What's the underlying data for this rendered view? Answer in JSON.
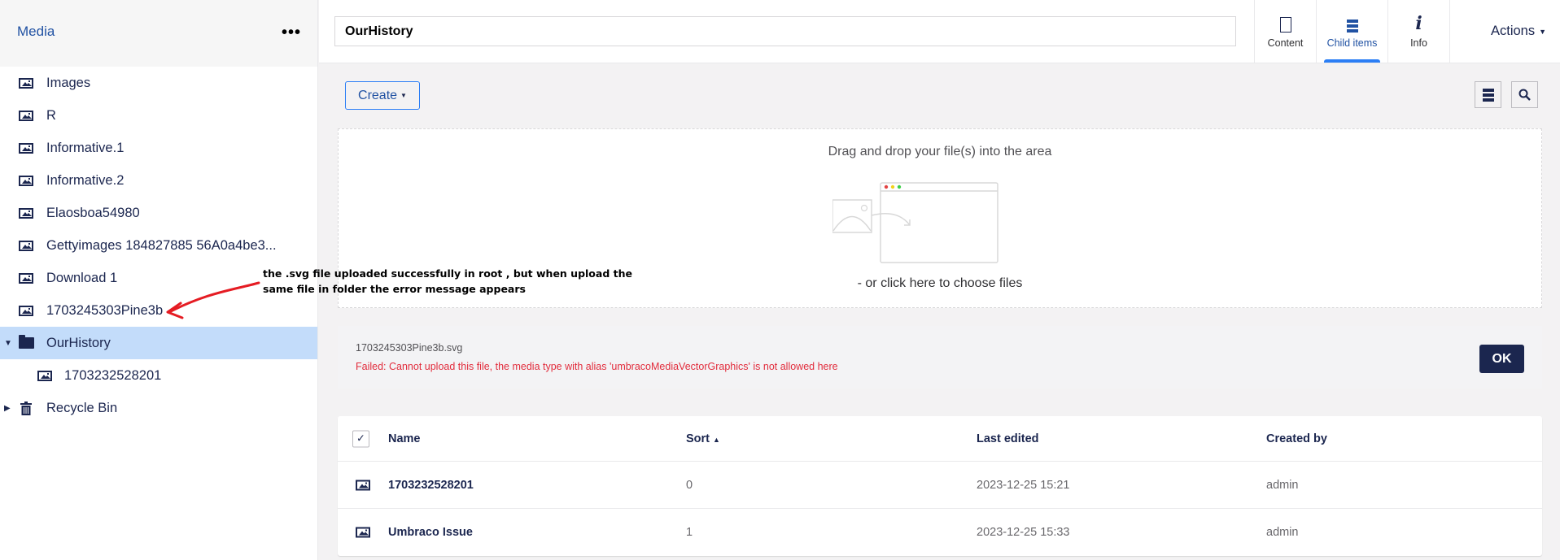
{
  "sidebar": {
    "title": "Media",
    "more_icon": "ellipsis-icon",
    "items": [
      {
        "label": "Images",
        "icon": "image-icon"
      },
      {
        "label": "R",
        "icon": "image-icon"
      },
      {
        "label": "Informative.1",
        "icon": "image-icon"
      },
      {
        "label": "Informative.2",
        "icon": "image-icon"
      },
      {
        "label": "Elaosboa54980",
        "icon": "image-icon"
      },
      {
        "label": "Gettyimages 184827885 56A0a4be3...",
        "icon": "image-icon"
      },
      {
        "label": "Download 1",
        "icon": "image-icon"
      },
      {
        "label": "1703245303Pine3b",
        "icon": "image-icon"
      },
      {
        "label": "OurHistory",
        "icon": "folder-icon",
        "expanded": true,
        "active": true
      },
      {
        "label": "1703232528201",
        "icon": "image-icon",
        "child": true
      },
      {
        "label": "Recycle Bin",
        "icon": "trash-icon",
        "collapsed": true
      }
    ]
  },
  "header": {
    "name_value": "OurHistory",
    "tabs": [
      {
        "label": "Content",
        "icon": "document-icon"
      },
      {
        "label": "Child items",
        "icon": "list-icon",
        "active": true
      },
      {
        "label": "Info",
        "icon": "info-icon"
      }
    ],
    "actions_label": "Actions"
  },
  "toolbar": {
    "create_label": "Create",
    "list_view_icon": "list-view-icon",
    "search_icon": "search-icon"
  },
  "dropzone": {
    "title": "Drag and drop your file(s) into the area",
    "subtitle": "- or click here to choose files"
  },
  "upload_error": {
    "filename": "1703245303Pine3b.svg",
    "message": "Failed: Cannot upload this file, the media type with alias 'umbracoMediaVectorGraphics' is not allowed here",
    "ok_label": "OK"
  },
  "table": {
    "columns": [
      "Name",
      "Sort",
      "Last edited",
      "Created by"
    ],
    "sort_indicator": "ascending",
    "rows": [
      {
        "name": "1703232528201",
        "sort": "0",
        "last_edited": "2023-12-25 15:21",
        "created_by": "admin"
      },
      {
        "name": "Umbraco Issue",
        "sort": "1",
        "last_edited": "2023-12-25 15:33",
        "created_by": "admin"
      }
    ]
  },
  "annotation": {
    "text_line1": "the .svg file uploaded successfully in root , but when upload the",
    "text_line2": "same file in folder the error message appears",
    "color": "#e51c23"
  }
}
